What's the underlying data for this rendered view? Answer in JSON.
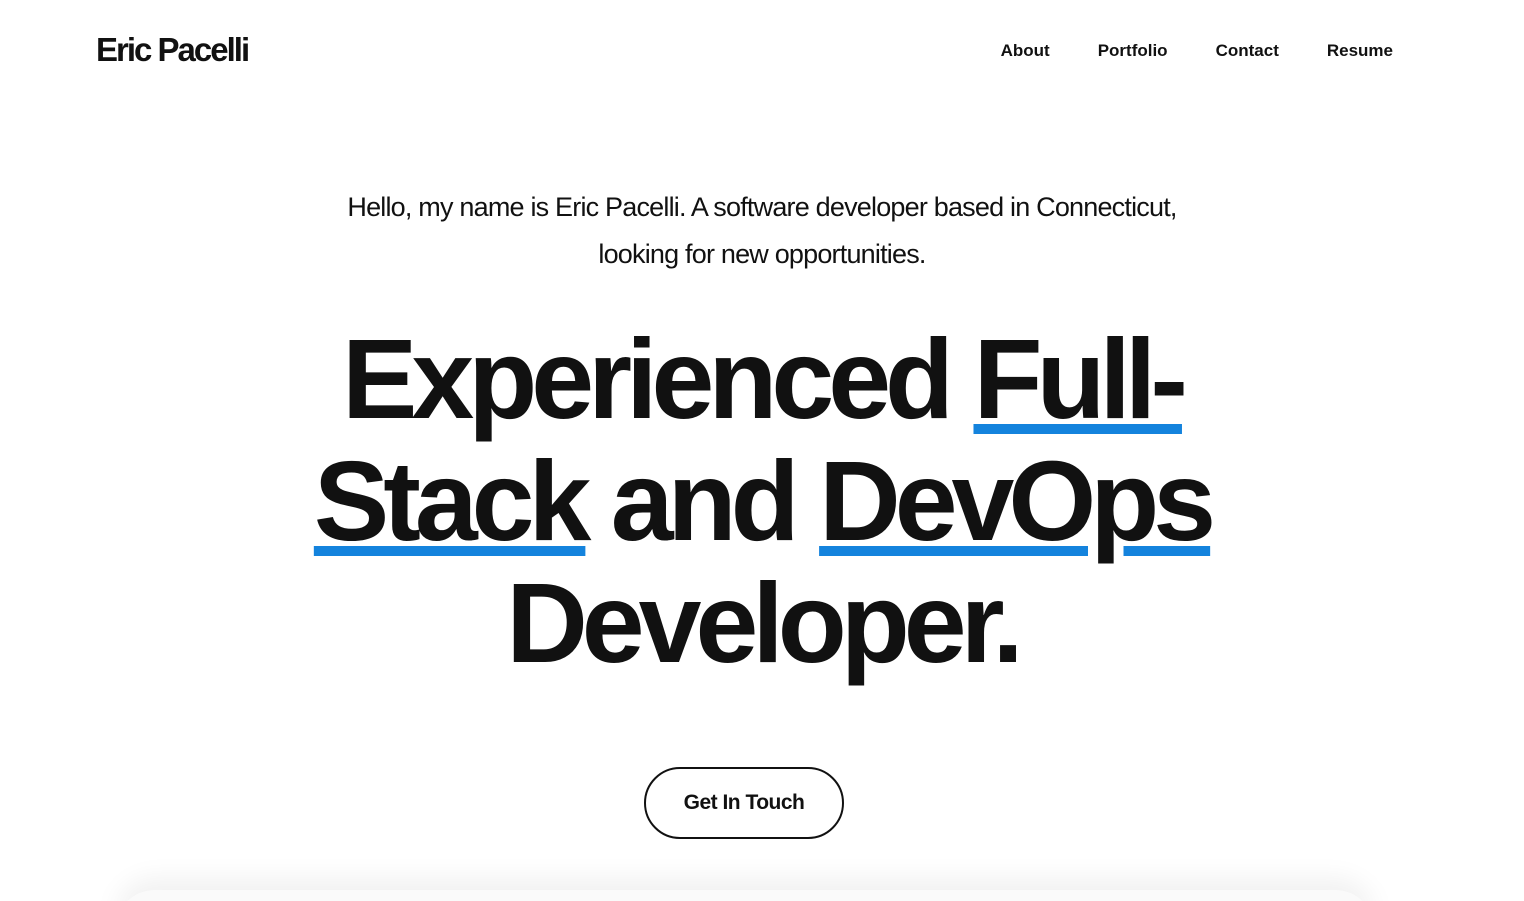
{
  "header": {
    "logo": "Eric Pacelli",
    "nav": [
      {
        "label": "About"
      },
      {
        "label": "Portfolio"
      },
      {
        "label": "Contact"
      },
      {
        "label": "Resume"
      }
    ]
  },
  "hero": {
    "intro_line1": "Hello, my name is Eric Pacelli. A software developer based in Connecticut,",
    "intro_line2": "looking for new opportunities.",
    "headline": {
      "w1": "Experienced",
      "w2": "Full-",
      "w3": "Stack",
      "w4": "and",
      "w5": "DevOps",
      "w6": "Developer."
    },
    "cta_label": "Get In Touch"
  },
  "colors": {
    "accent": "#1483dd",
    "text": "#111111",
    "background": "#ffffff"
  }
}
